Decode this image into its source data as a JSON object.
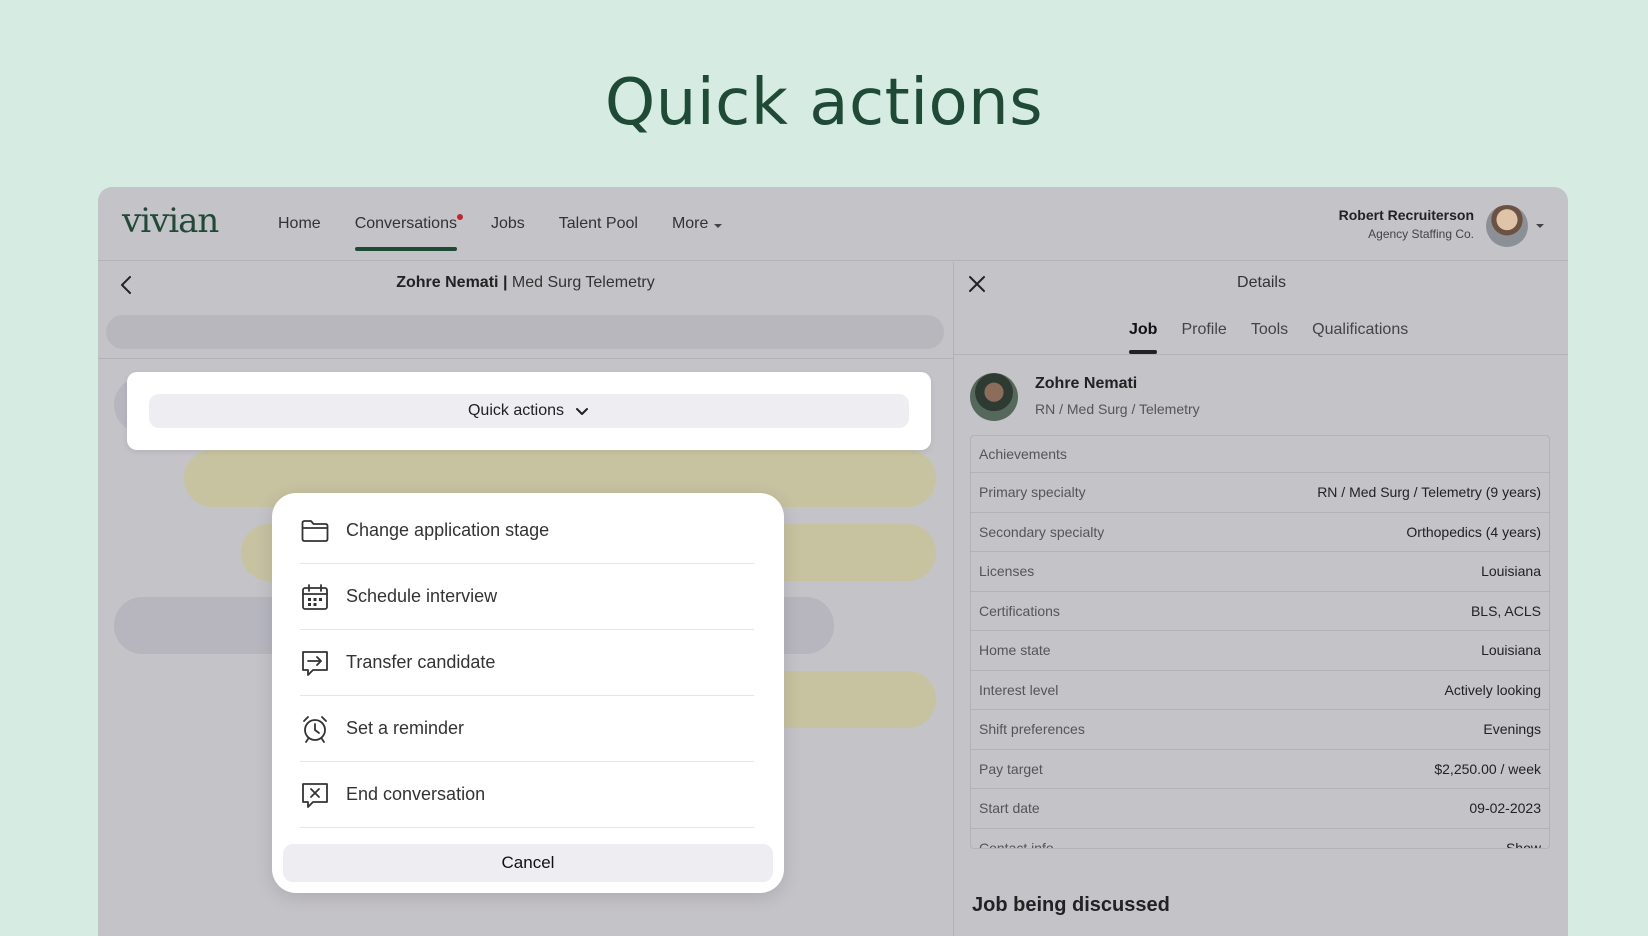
{
  "hero": {
    "title": "Quick actions"
  },
  "nav": {
    "logo": "vivian",
    "items": [
      {
        "label": "Home"
      },
      {
        "label": "Conversations",
        "active": true,
        "has_notification": true
      },
      {
        "label": "Jobs"
      },
      {
        "label": "Talent Pool"
      },
      {
        "label": "More",
        "dropdown": true
      }
    ],
    "user": {
      "name": "Robert Recruiterson",
      "company": "Agency Staffing Co."
    }
  },
  "conversation": {
    "candidate_name": "Zohre Nemati",
    "separator": "|",
    "job": "Med Surg Telemetry"
  },
  "quick_actions": {
    "button_label": "Quick actions",
    "items": [
      {
        "label": "Change application stage",
        "icon": "folder-icon"
      },
      {
        "label": "Schedule interview",
        "icon": "calendar-icon"
      },
      {
        "label": "Transfer candidate",
        "icon": "transfer-icon"
      },
      {
        "label": "Set a reminder",
        "icon": "alarm-clock-icon"
      },
      {
        "label": "End conversation",
        "icon": "end-chat-icon"
      }
    ],
    "cancel_label": "Cancel"
  },
  "details": {
    "title": "Details",
    "tabs": [
      {
        "label": "Job",
        "active": true
      },
      {
        "label": "Profile"
      },
      {
        "label": "Tools"
      },
      {
        "label": "Qualifications"
      }
    ],
    "candidate": {
      "name": "Zohre Nemati",
      "role": "RN / Med Surg / Telemetry"
    },
    "table_header": "Achievements",
    "rows": [
      {
        "key": "Primary specialty",
        "value": "RN / Med Surg / Telemetry (9 years)"
      },
      {
        "key": "Secondary specialty",
        "value": "Orthopedics (4 years)"
      },
      {
        "key": "Licenses",
        "value": "Louisiana"
      },
      {
        "key": "Certifications",
        "value": "BLS, ACLS"
      },
      {
        "key": "Home state",
        "value": "Louisiana"
      },
      {
        "key": "Interest level",
        "value": "Actively looking"
      },
      {
        "key": "Shift preferences",
        "value": "Evenings"
      },
      {
        "key": "Pay target",
        "value": "$2,250.00 / week"
      },
      {
        "key": "Start date",
        "value": "09-02-2023"
      },
      {
        "key": "Contact info",
        "value": "Show"
      }
    ],
    "section_title": "Job being discussed"
  },
  "colors": {
    "background": "#d6ece2",
    "brand": "#1f4a36",
    "overlay": "#c4c3c8",
    "notification": "#c0272d"
  }
}
